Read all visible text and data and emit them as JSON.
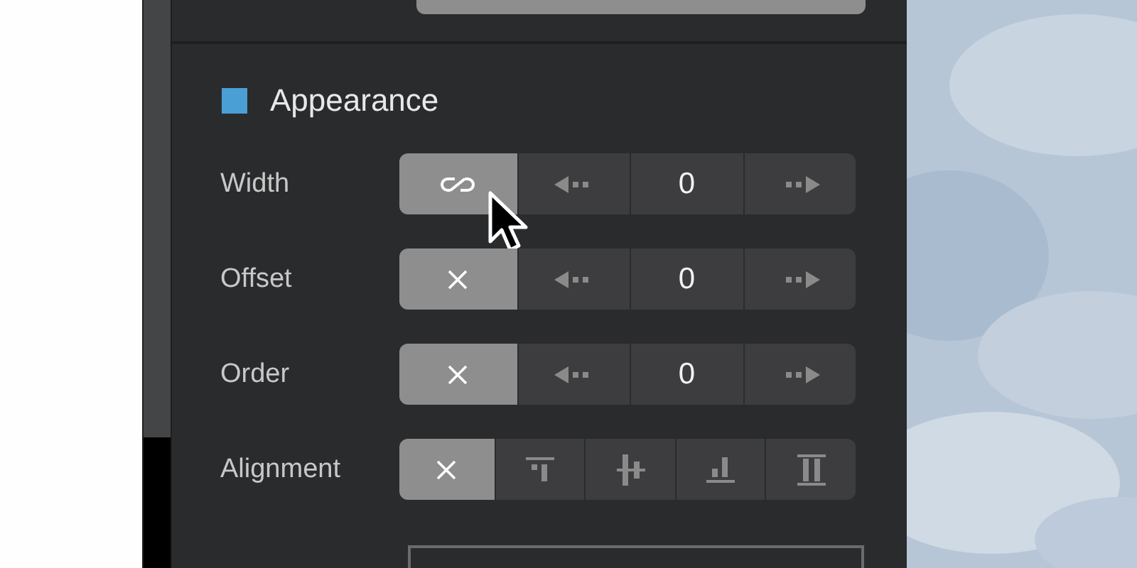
{
  "section": {
    "title": "Appearance",
    "color": "#4a9fd4"
  },
  "rows": [
    {
      "label": "Width",
      "kind": "stepper",
      "segments": [
        {
          "kind": "link",
          "selected": true
        },
        {
          "kind": "decrement",
          "selected": false
        },
        {
          "kind": "value",
          "text": "0",
          "selected": false
        },
        {
          "kind": "increment",
          "selected": false
        }
      ]
    },
    {
      "label": "Offset",
      "kind": "stepper",
      "segments": [
        {
          "kind": "none",
          "selected": true
        },
        {
          "kind": "decrement",
          "selected": false
        },
        {
          "kind": "value",
          "text": "0",
          "selected": false
        },
        {
          "kind": "increment",
          "selected": false
        }
      ]
    },
    {
      "label": "Order",
      "kind": "stepper",
      "segments": [
        {
          "kind": "none",
          "selected": true
        },
        {
          "kind": "decrement",
          "selected": false
        },
        {
          "kind": "value",
          "text": "0",
          "selected": false
        },
        {
          "kind": "increment",
          "selected": false
        }
      ]
    },
    {
      "label": "Alignment",
      "kind": "align",
      "segments": [
        {
          "kind": "none",
          "selected": true
        },
        {
          "kind": "top",
          "selected": false
        },
        {
          "kind": "center",
          "selected": false
        },
        {
          "kind": "bottom",
          "selected": false
        },
        {
          "kind": "stretch",
          "selected": false
        }
      ]
    }
  ]
}
